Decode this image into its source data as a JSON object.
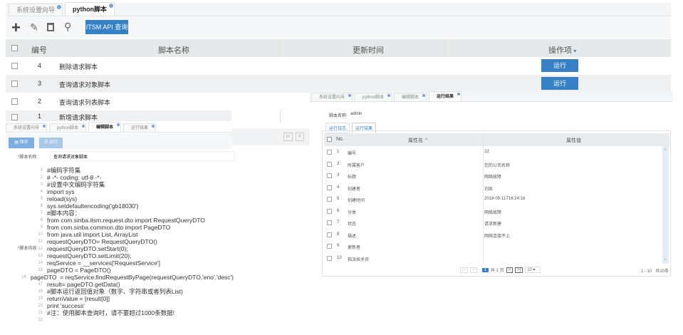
{
  "main": {
    "tabs": [
      {
        "label": "系统设置向导",
        "active": false
      },
      {
        "label": "python脚本",
        "active": true
      }
    ],
    "toolbar": {
      "add_icon": "plus-icon",
      "edit_icon": "pencil-icon",
      "delete_icon": "trash-icon",
      "search_icon": "search-icon",
      "api_button": "ITSM API 查询"
    },
    "columns": [
      "编号",
      "脚本名称",
      "更新时间",
      "操作项"
    ],
    "sort_icon": "sort-icon",
    "rows": [
      {
        "id": "4",
        "name": "删除请求脚本",
        "updated": "",
        "action": "运行"
      },
      {
        "id": "3",
        "name": "查询请求对象脚本",
        "updated": "",
        "action": "运行"
      },
      {
        "id": "2",
        "name": "查询请求列表脚本",
        "updated": "",
        "action": ""
      },
      {
        "id": "1",
        "name": "新增请求脚本",
        "updated": "",
        "action": ""
      }
    ],
    "pager": {
      "first": "|<",
      "prev": "<"
    }
  },
  "editor": {
    "tabs": [
      {
        "label": "系统设置向导"
      },
      {
        "label": "python脚本"
      },
      {
        "label": "编辑脚本",
        "active": true
      },
      {
        "label": "运行结果"
      }
    ],
    "save_button": "保存",
    "run_button": "运行",
    "name_label": "*脚本名称:",
    "name_value": "查询请求对象脚本",
    "content_label": "*脚本内容:",
    "code": [
      "#编码字符集",
      "# -*- coding: utf-8 -*-",
      "#设置中文编码字符集",
      "import sys",
      "reload(sys)",
      "sys.setdefaultencoding('gb18030')",
      "#脚本内容：",
      "from com.sinba.itsm.request.dto import RequestQueryDTO",
      "from com.sinba.common.dto import PageDTO",
      "from java.util import List, ArrayList",
      "requestQueryDTO= RequestQueryDTO()",
      "requestQueryDTO.setStart(0);",
      "requestQueryDTO.setLimit(20);",
      "reqService = __services['RequestService']",
      "pageDTO = PageDTO()",
      "pageDTO  = reqService.findRequestByPage(requestQueryDTO,'eno','desc')",
      "result= pageDTO.getData()",
      "#脚本运行返回值对象（数字、字符串或者列表List)",
      "returnValue = [result[0]]",
      "print 'success'",
      "#注：使用脚本查询时，请不要超过1000条数据!",
      ""
    ]
  },
  "result": {
    "tabs": [
      {
        "label": "系统设置向导"
      },
      {
        "label": "python脚本"
      },
      {
        "label": "编辑脚本"
      },
      {
        "label": "运行结果",
        "active": true
      }
    ],
    "name_label": "脚本名称:",
    "name_value": "admin",
    "subtabs": [
      {
        "label": "运行日志"
      },
      {
        "label": "运行结果",
        "active": true
      }
    ],
    "columns": [
      "No.",
      "属性名 ⌃",
      "属性值"
    ],
    "rows": [
      {
        "no": "1",
        "name": "编号",
        "value": "22"
      },
      {
        "no": "2",
        "name": "所属客户",
        "value": "您的公司名称"
      },
      {
        "no": "3",
        "name": "标题",
        "value": "网络故障"
      },
      {
        "no": "4",
        "name": "创建者",
        "value": "刘凯"
      },
      {
        "no": "5",
        "name": "创建时间",
        "value": "2018-09-11T16:24:18"
      },
      {
        "no": "6",
        "name": "分类",
        "value": "网络故障"
      },
      {
        "no": "7",
        "name": "状态",
        "value": "请求新建"
      },
      {
        "no": "8",
        "name": "描述",
        "value": "网络连接不上"
      },
      {
        "no": "9",
        "name": "更新者",
        "value": ""
      },
      {
        "no": "10",
        "name": "指派技术员",
        "value": ""
      }
    ],
    "pager": {
      "first": "|<",
      "prev": "<",
      "page": "1",
      "total": "共 1 页",
      "next": ">",
      "last": ">|",
      "page_size": "10",
      "summary": "1 - 10   共10条"
    }
  }
}
